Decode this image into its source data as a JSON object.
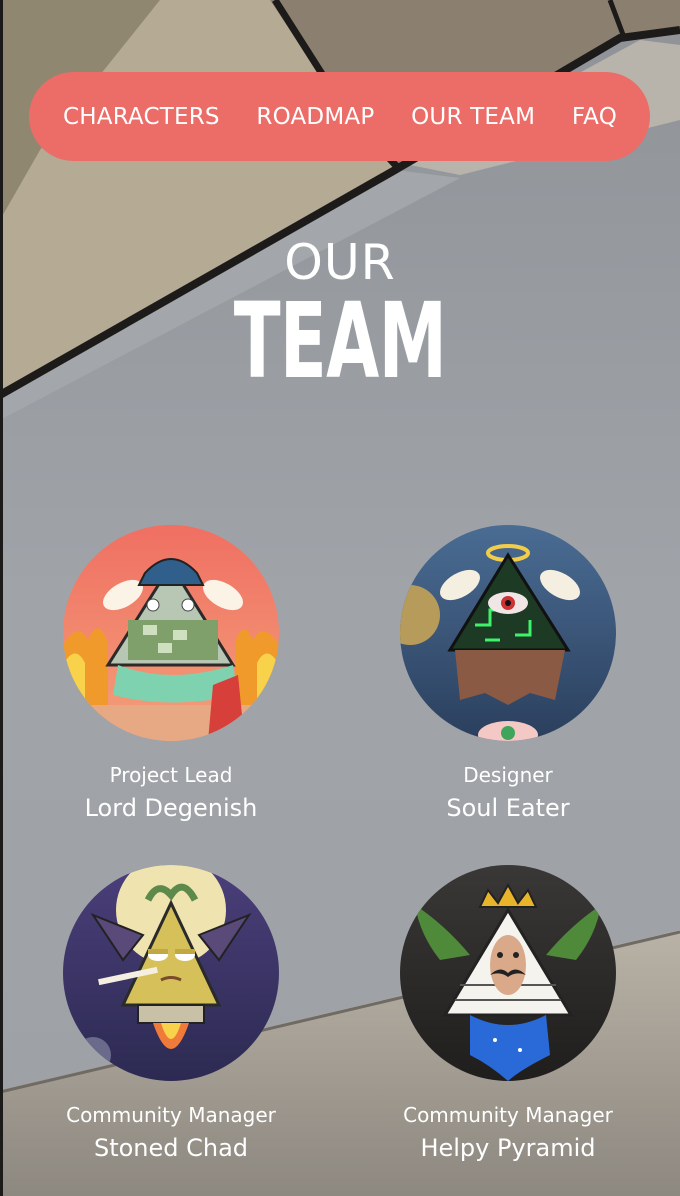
{
  "nav": {
    "items": [
      {
        "label": "CHARACTERS"
      },
      {
        "label": "ROADMAP"
      },
      {
        "label": "OUR TEAM"
      },
      {
        "label": "FAQ"
      }
    ]
  },
  "heading": {
    "line1": "OUR",
    "line2": "TEAM"
  },
  "team": [
    {
      "role": "Project Lead",
      "name": "Lord Degenish",
      "avatar_icon": "pyramid-bucket-hat-avatar"
    },
    {
      "role": "Designer",
      "name": "Soul Eater",
      "avatar_icon": "pyramid-eye-halo-avatar"
    },
    {
      "role": "Community Manager",
      "name": "Stoned Chad",
      "avatar_icon": "pyramid-stoned-avatar"
    },
    {
      "role": "Community Manager",
      "name": "Helpy Pyramid",
      "avatar_icon": "pyramid-mustache-avatar"
    }
  ],
  "colors": {
    "nav_background": "#ec6c68",
    "text": "#ffffff",
    "page_background": "#9a9ea3"
  }
}
